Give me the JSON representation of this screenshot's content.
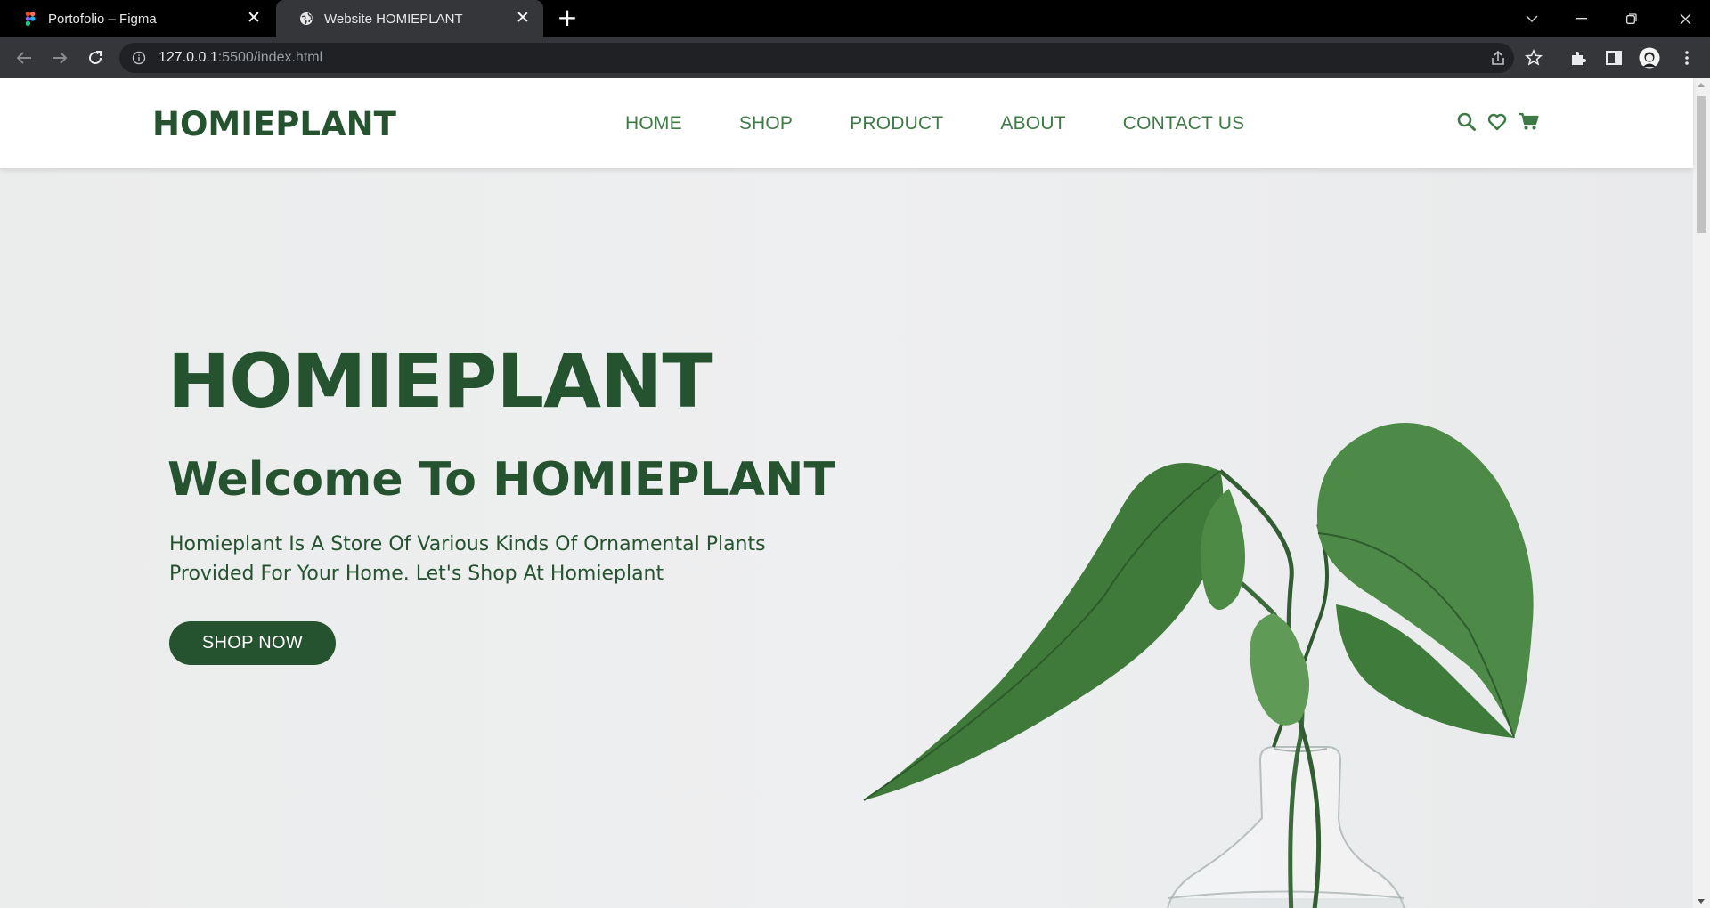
{
  "browser": {
    "tabs": [
      {
        "title": "Portofolio – Figma",
        "active": false
      },
      {
        "title": "Website HOMIEPLANT",
        "active": true
      }
    ],
    "url_host": "127.0.0.1",
    "url_rest": ":5500/index.html"
  },
  "site": {
    "logo": "HOMIEPLANT",
    "nav": [
      "HOME",
      "SHOP",
      "PRODUCT",
      "ABOUT",
      "CONTACT US"
    ],
    "header_icons": [
      "search-icon",
      "heart-icon",
      "cart-icon"
    ]
  },
  "hero": {
    "title": "HOMIEPLANT",
    "subtitle": "Welcome To HOMIEPLANT",
    "description_line1": "Homieplant Is A Store Of Various Kinds Of Ornamental Plants",
    "description_line2": "Provided For Your Home. Let's Shop At Homieplant",
    "cta": "SHOP NOW"
  },
  "colors": {
    "brand_dark_green": "#25522f",
    "nav_green": "#3d7a45",
    "hero_bg": "#eceded",
    "chrome_dark": "#35363a"
  }
}
